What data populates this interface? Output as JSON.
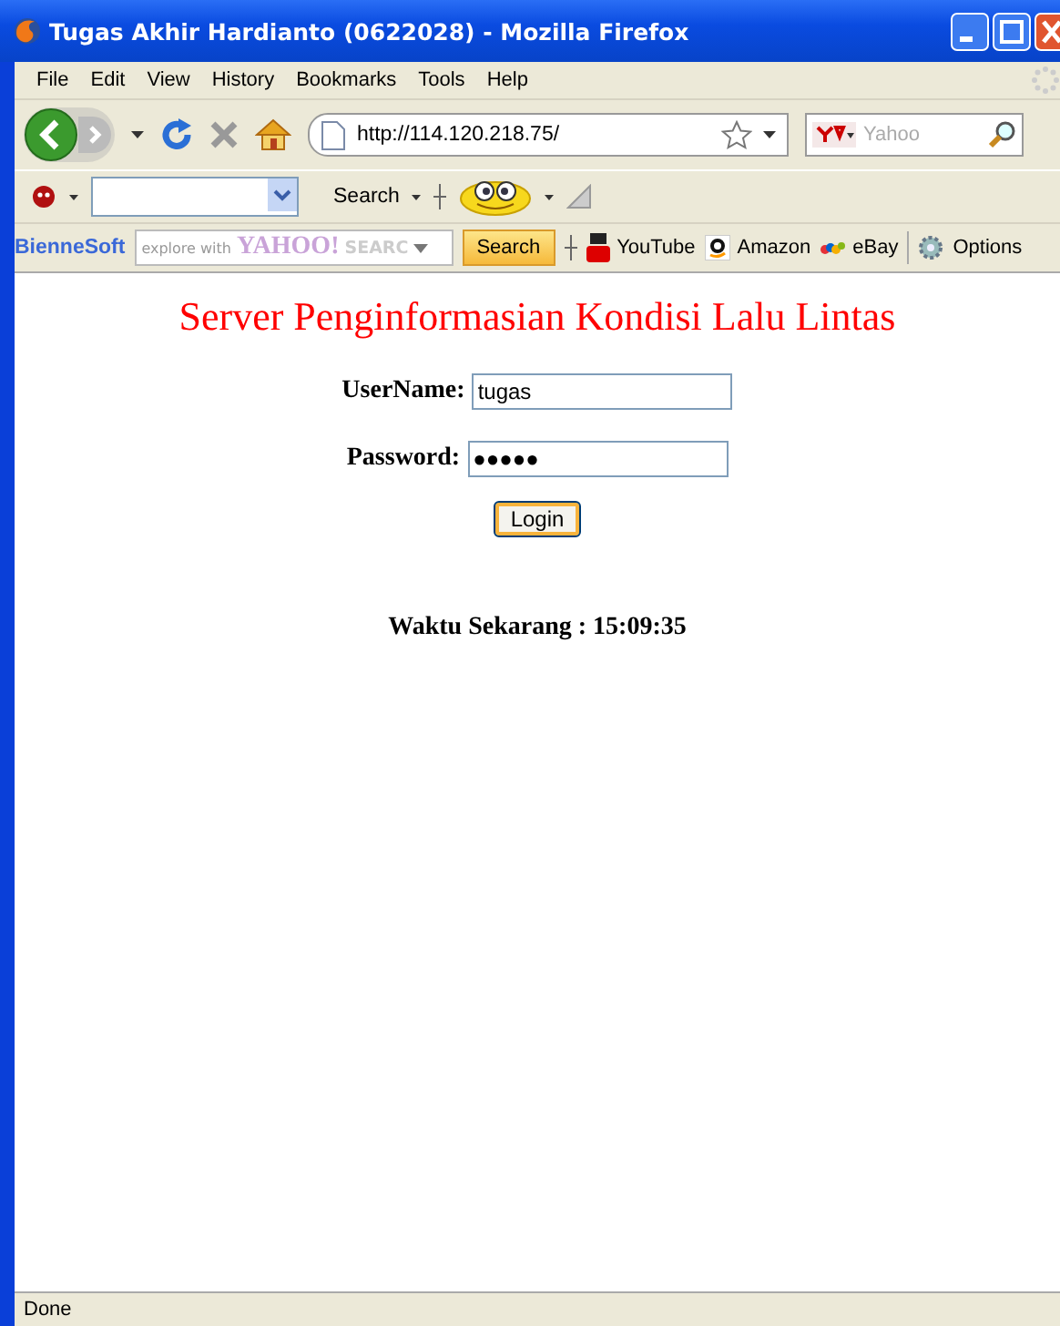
{
  "window": {
    "title": "Tugas Akhir Hardianto (0622028) - Mozilla Firefox"
  },
  "menu": [
    "File",
    "Edit",
    "View",
    "History",
    "Bookmarks",
    "Tools",
    "Help"
  ],
  "navigation": {
    "url": "http://114.120.218.75/",
    "search_placeholder": "Yahoo"
  },
  "search_toolbar": {
    "search_button": "Search"
  },
  "bienne_toolbar": {
    "brand": "BienneSoft",
    "search_hint": "explore with",
    "yahoo_logo": "YAHOO!",
    "search_label": "SEARC",
    "search_button": "Search",
    "links": [
      "YouTube",
      "Amazon",
      "eBay"
    ],
    "options": "Options"
  },
  "page": {
    "heading": "Server Penginformasian Kondisi Lalu Lintas",
    "fields": [
      {
        "label": "UserName:",
        "value": "tugas"
      },
      {
        "label": "Password:",
        "value": "●●●●●"
      }
    ],
    "button": "Login",
    "clock": "Waktu Sekarang : 15:09:35"
  },
  "status_bar": {
    "text": "Done"
  }
}
